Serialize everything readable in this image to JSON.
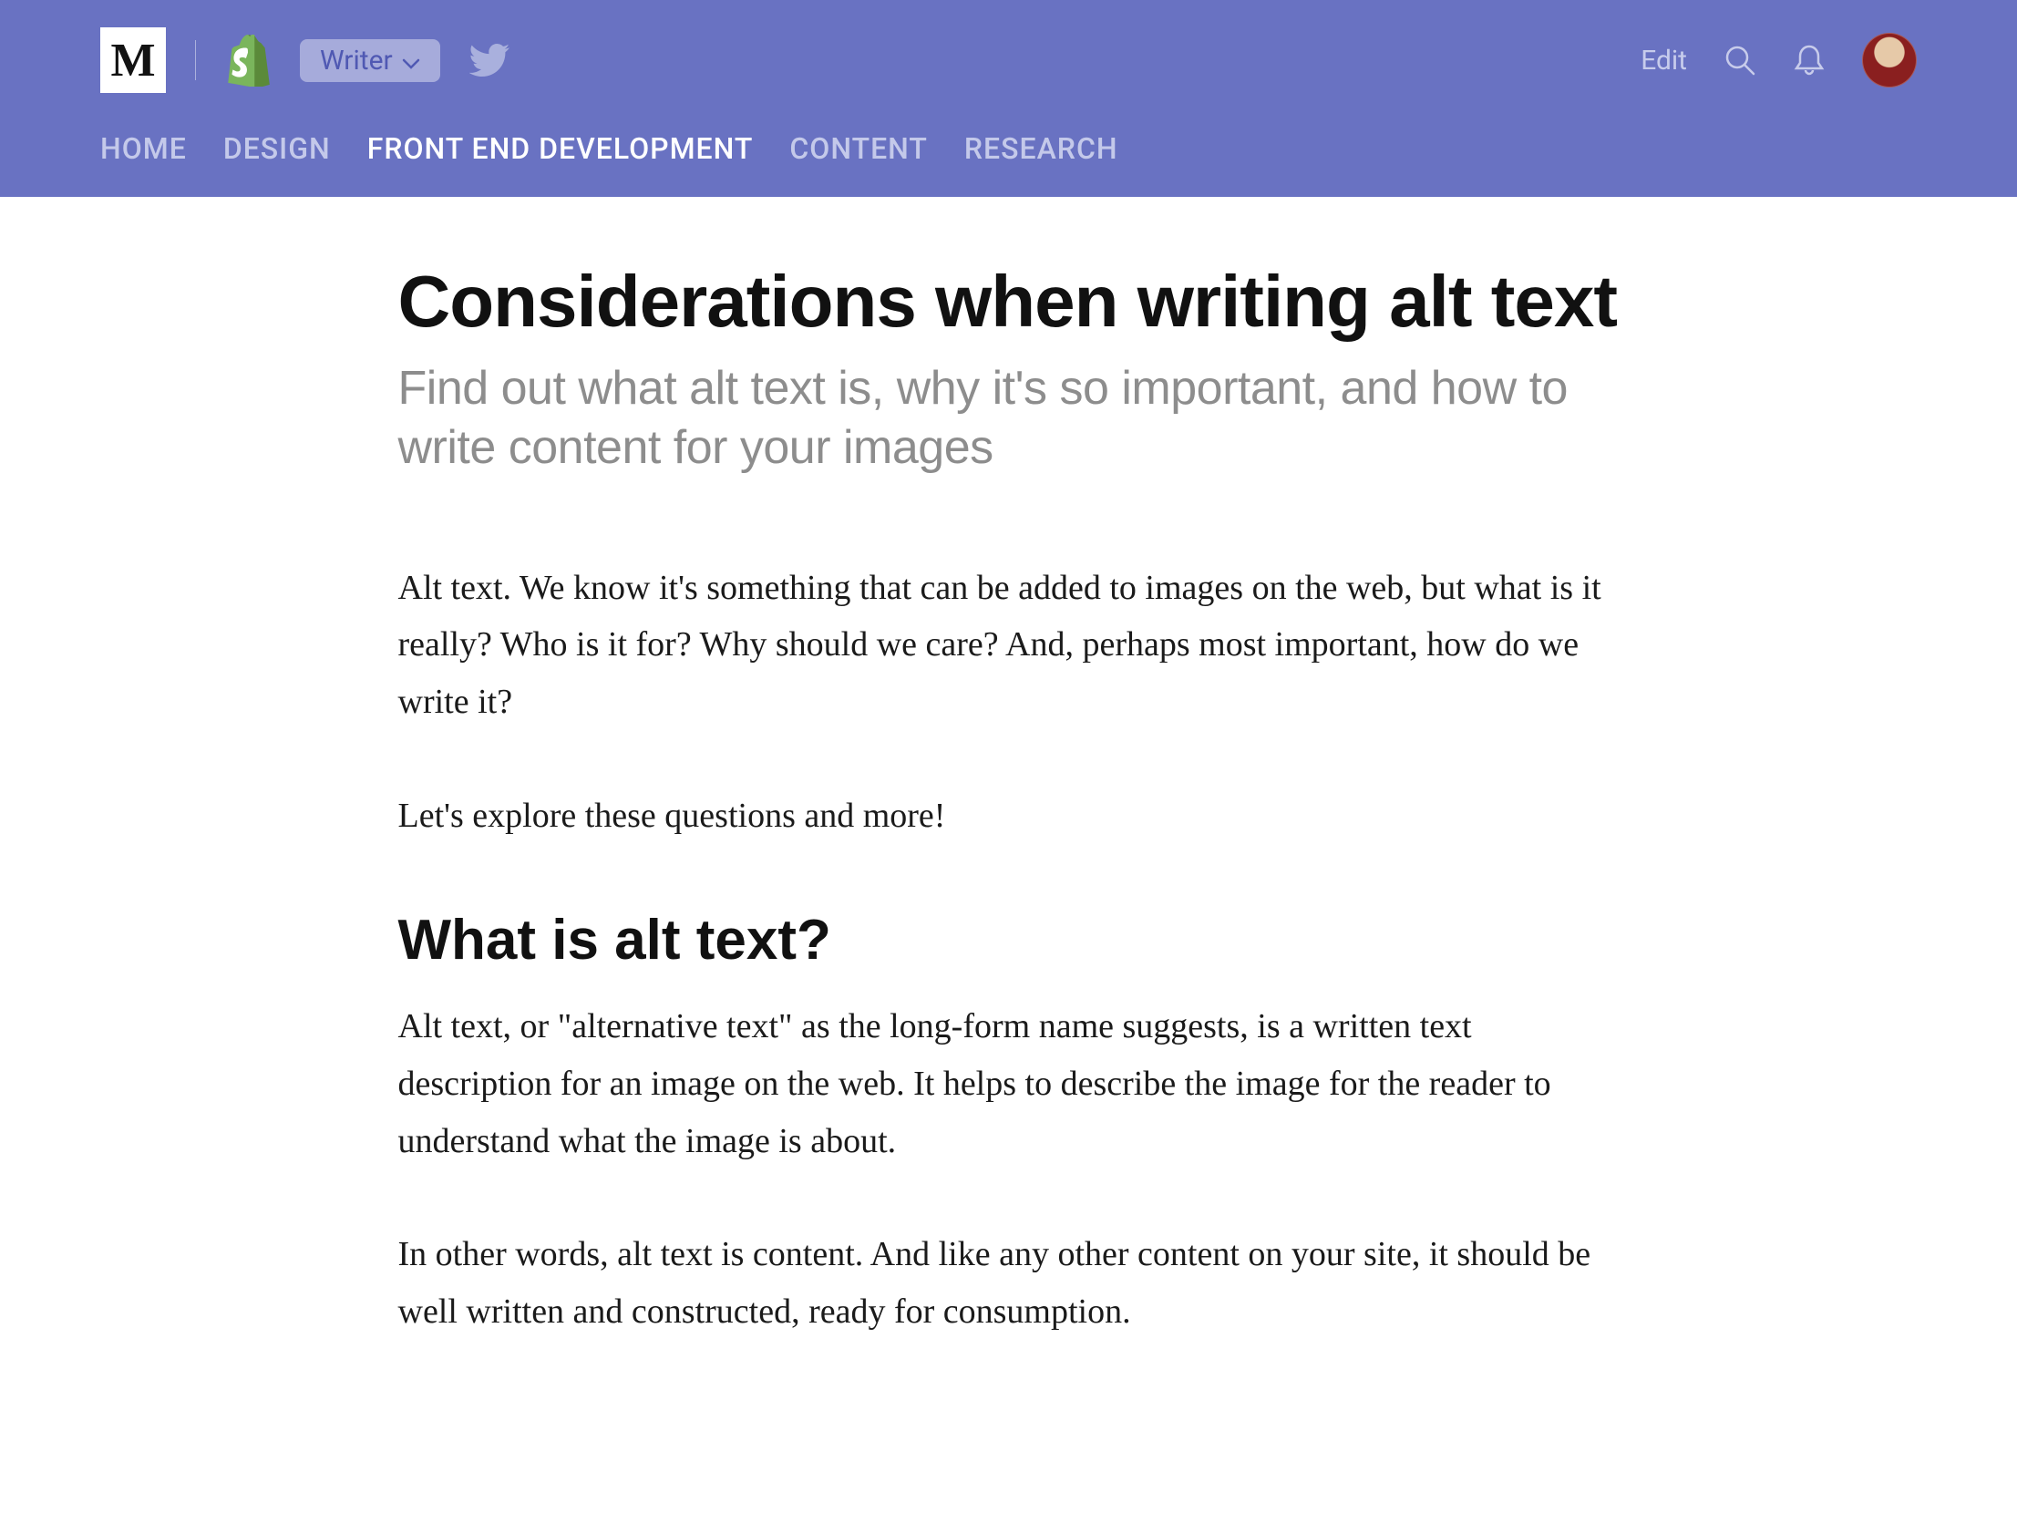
{
  "header": {
    "writer_label": "Writer",
    "edit_label": "Edit",
    "nav": [
      {
        "label": "HOME",
        "active": false
      },
      {
        "label": "DESIGN",
        "active": false
      },
      {
        "label": "FRONT END DEVELOPMENT",
        "active": true
      },
      {
        "label": "CONTENT",
        "active": false
      },
      {
        "label": "RESEARCH",
        "active": false
      }
    ]
  },
  "article": {
    "title": "Considerations when writing alt text",
    "subtitle": "Find out what alt text is, why it's so important, and how to write content for your images",
    "p1": "Alt text. We know it's something that can be added to images on the web, but what is it really? Who is it for? Why should we care? And, perhaps most important, how do we write it?",
    "p2": "Let's explore these questions and more!",
    "h2_1": "What is alt text?",
    "p3": "Alt text, or \"alternative text\" as the long-form name suggests, is a written text description for an image on the web. It helps to describe the image for the reader to understand what the image is about.",
    "p4": "In other words, alt text is content. And like any other content on your site, it should be well written and constructed, ready for consumption."
  }
}
